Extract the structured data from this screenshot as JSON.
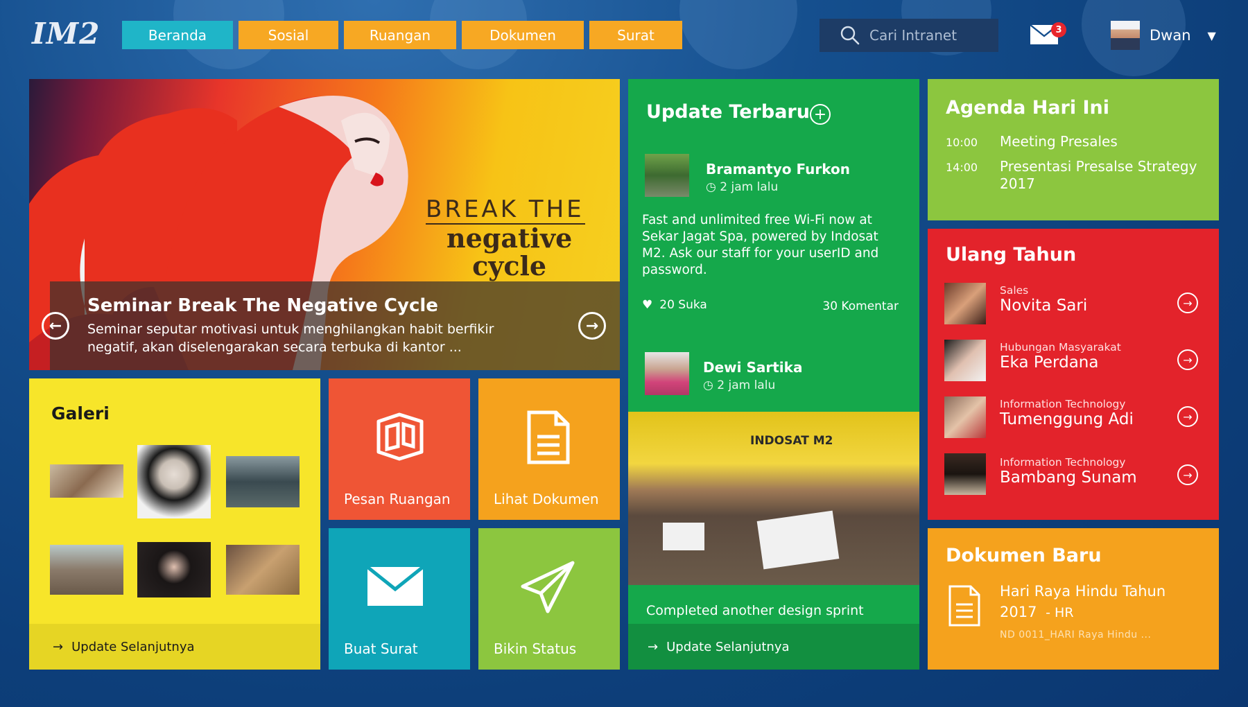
{
  "header": {
    "logo": "IM2",
    "nav": [
      {
        "label": "Beranda",
        "color": "#1fb5c8",
        "active": true
      },
      {
        "label": "Sosial",
        "color": "#f7a823"
      },
      {
        "label": "Ruangan",
        "color": "#f7a823"
      },
      {
        "label": "Dokumen",
        "color": "#f7a823"
      },
      {
        "label": "Surat",
        "color": "#f7a823"
      }
    ],
    "search_placeholder": "Cari Intranet",
    "mail_badge": "3",
    "user_name": "Dwan"
  },
  "hero": {
    "image_text_line1": "BREAK THE",
    "image_text_line2": "negative",
    "image_text_line3": "cycle",
    "title": "Seminar Break The Negative Cycle",
    "description": "Seminar seputar motivasi untuk menghilangkan habit berfikir negatif, akan diselengarakan secara terbuka di kantor ..."
  },
  "update": {
    "title": "Update Terbaru",
    "posts": [
      {
        "author": "Bramantyo Furkon",
        "time": "2 jam lalu",
        "body": "Fast and unlimited free Wi-Fi now at Sekar Jagat Spa, powered by Indosat M2. Ask our staff for your userID and password.",
        "likes": "20 Suka",
        "comments": "30 Komentar"
      },
      {
        "author": "Dewi Sartika",
        "time": "2 jam lalu"
      }
    ],
    "photo_caption": "Completed another design sprint",
    "photo_sign": "INDOSAT M2",
    "more_link": "Update Selanjutnya"
  },
  "agenda": {
    "title": "Agenda Hari Ini",
    "items": [
      {
        "time": "10:00",
        "title": "Meeting Presales"
      },
      {
        "time": "14:00",
        "title": "Presentasi Presalse Strategy 2017"
      }
    ]
  },
  "birthday": {
    "title": "Ulang Tahun",
    "people": [
      {
        "dept": "Sales",
        "name": "Novita Sari"
      },
      {
        "dept": "Hubungan Masyarakat",
        "name": "Eka Perdana"
      },
      {
        "dept": "Information Technology",
        "name": "Tumenggung Adi"
      },
      {
        "dept": "Information Technology",
        "name": "Bambang Sunam"
      }
    ]
  },
  "docs": {
    "title": "Dokumen Baru",
    "doc_title": "Hari Raya Hindu Tahun 2017",
    "doc_dept": "- HR",
    "doc_file": "ND 0011_HARI Raya Hindu ..."
  },
  "galeri": {
    "title": "Galeri",
    "more_link": "Update Selanjutnya"
  },
  "actions": {
    "pesan_ruangan": "Pesan Ruangan",
    "lihat_dokumen": "Lihat Dokumen",
    "buat_surat": "Buat Surat",
    "bikin_status": "Bikin Status"
  },
  "colors": {
    "action_red": "#ef5535",
    "action_orange": "#f5a21d",
    "action_teal": "#0fa5b8",
    "action_green": "#8cc63f"
  }
}
